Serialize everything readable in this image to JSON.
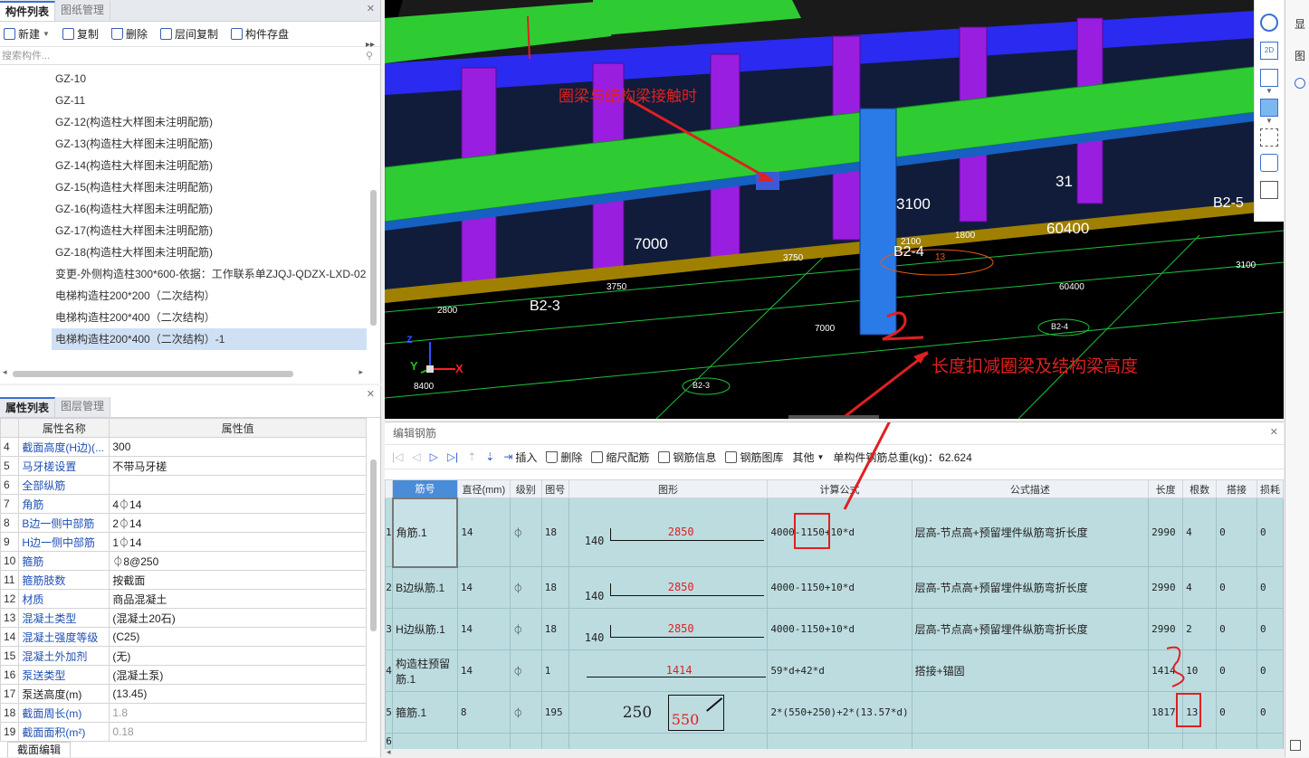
{
  "component_panel": {
    "tabs": [
      "构件列表",
      "图纸管理"
    ],
    "toolbar": {
      "new": "新建",
      "copy": "复制",
      "delete": "删除",
      "floor_copy": "层间复制",
      "save": "构件存盘"
    },
    "search_placeholder": "搜索构件...",
    "items": [
      "GZ-10",
      "GZ-11",
      "GZ-12(构造柱大样图未注明配筋)",
      "GZ-13(构造柱大样图未注明配筋)",
      "GZ-14(构造柱大样图未注明配筋)",
      "GZ-15(构造柱大样图未注明配筋)",
      "GZ-16(构造柱大样图未注明配筋)",
      "GZ-17(构造柱大样图未注明配筋)",
      "GZ-18(构造柱大样图未注明配筋)",
      "变更-外侧构造柱300*600-依据：工作联系单ZJQJ-QDZX-LXD-02",
      "电梯构造柱200*200（二次结构）",
      "电梯构造柱200*400（二次结构）",
      "电梯构造柱200*400（二次结构）-1"
    ],
    "selected_index": 12
  },
  "property_panel": {
    "tabs": [
      "属性列表",
      "图层管理"
    ],
    "headers": [
      "属性名称",
      "属性值"
    ],
    "rows": [
      {
        "n": "4",
        "name": "截面高度(H边)(...",
        "value": "300",
        "blue": true
      },
      {
        "n": "5",
        "name": "马牙槎设置",
        "value": "不带马牙槎",
        "blue": true
      },
      {
        "n": "6",
        "name": "全部纵筋",
        "value": "",
        "blue": true
      },
      {
        "n": "7",
        "name": "角筋",
        "value": "4⏀14",
        "blue": true
      },
      {
        "n": "8",
        "name": "B边一侧中部筋",
        "value": "2⏀14",
        "blue": true
      },
      {
        "n": "9",
        "name": "H边一侧中部筋",
        "value": "1⏀14",
        "blue": true
      },
      {
        "n": "10",
        "name": "箍筋",
        "value": "⏀8@250",
        "blue": true
      },
      {
        "n": "11",
        "name": "箍筋肢数",
        "value": "按截面",
        "blue": true
      },
      {
        "n": "12",
        "name": "材质",
        "value": "商品混凝土",
        "blue": true
      },
      {
        "n": "13",
        "name": "混凝土类型",
        "value": "(混凝土20石)",
        "blue": true
      },
      {
        "n": "14",
        "name": "混凝土强度等级",
        "value": "(C25)",
        "blue": true
      },
      {
        "n": "15",
        "name": "混凝土外加剂",
        "value": "(无)",
        "blue": true
      },
      {
        "n": "16",
        "name": "泵送类型",
        "value": "(混凝土泵)",
        "blue": true
      },
      {
        "n": "17",
        "name": "泵送高度(m)",
        "value": "(13.45)",
        "blue": false
      },
      {
        "n": "18",
        "name": "截面周长(m)",
        "value": "1.8",
        "blue": true,
        "gray": true
      },
      {
        "n": "19",
        "name": "截面面积(m²)",
        "value": "0.18",
        "blue": true,
        "gray": true
      }
    ],
    "bottom_tab": "截面编辑"
  },
  "view3d": {
    "annotation_top": "圈梁与结构梁接触时",
    "annotation_bottom": "长度扣减圈梁及结构梁高度",
    "labels": [
      "B2-3",
      "B2-4",
      "B2-5",
      "7000",
      "3100",
      "60400",
      "31",
      "2800",
      "3750",
      "3750",
      "7000",
      "2100",
      "1800",
      "13",
      "60400",
      "3100",
      "8400",
      "B2-3",
      "B2-4"
    ],
    "handwritten": "2",
    "axes": {
      "x": "X",
      "y": "Y",
      "z": "Z"
    }
  },
  "rebar_editor": {
    "title": "编辑钢筋",
    "toolbar": {
      "insert": "插入",
      "delete": "删除",
      "scale": "缩尺配筋",
      "info": "钢筋信息",
      "lib": "钢筋图库",
      "other": "其他",
      "total": "单构件钢筋总重(kg)：62.624"
    },
    "headers": [
      "筋号",
      "直径(mm)",
      "级别",
      "图号",
      "图形",
      "计算公式",
      "公式描述",
      "长度",
      "根数",
      "搭接",
      "损耗"
    ],
    "rows": [
      {
        "n": "1",
        "name": "角筋.1",
        "dia": "14",
        "grade": "⏀",
        "fig": "18",
        "hook": "140",
        "len_label": "2850",
        "formula": "4000-1150+10*d",
        "desc": "层高-节点高+预留埋件纵筋弯折长度",
        "length": "2990",
        "count": "4",
        "lap": "0",
        "loss": "0"
      },
      {
        "n": "2",
        "name": "B边纵筋.1",
        "dia": "14",
        "grade": "⏀",
        "fig": "18",
        "hook": "140",
        "len_label": "2850",
        "formula": "4000-1150+10*d",
        "desc": "层高-节点高+预留埋件纵筋弯折长度",
        "length": "2990",
        "count": "4",
        "lap": "0",
        "loss": "0"
      },
      {
        "n": "3",
        "name": "H边纵筋.1",
        "dia": "14",
        "grade": "⏀",
        "fig": "18",
        "hook": "140",
        "len_label": "2850",
        "formula": "4000-1150+10*d",
        "desc": "层高-节点高+预留埋件纵筋弯折长度",
        "length": "2990",
        "count": "2",
        "lap": "0",
        "loss": "0"
      },
      {
        "n": "4",
        "name": "构造柱预留筋.1",
        "dia": "14",
        "grade": "⏀",
        "fig": "1",
        "hook": "",
        "len_label": "1414",
        "formula": "59*d+42*d",
        "desc": "搭接+锚固",
        "length": "1414",
        "count": "10",
        "lap": "0",
        "loss": "0"
      },
      {
        "n": "5",
        "name": "箍筋.1",
        "dia": "8",
        "grade": "⏀",
        "fig": "195",
        "hook": "250",
        "len_label": "550",
        "formula": "2*(550+250)+2*(13.57*d)",
        "desc": "",
        "length": "1817",
        "count": "13",
        "lap": "0",
        "loss": "0"
      },
      {
        "n": "6",
        "name": "",
        "dia": "",
        "grade": "",
        "fig": "",
        "hook": "",
        "len_label": "",
        "formula": "",
        "desc": "",
        "length": "",
        "count": "",
        "lap": "",
        "loss": ""
      }
    ]
  },
  "right_panel": {
    "title": "显",
    "item": "图"
  }
}
